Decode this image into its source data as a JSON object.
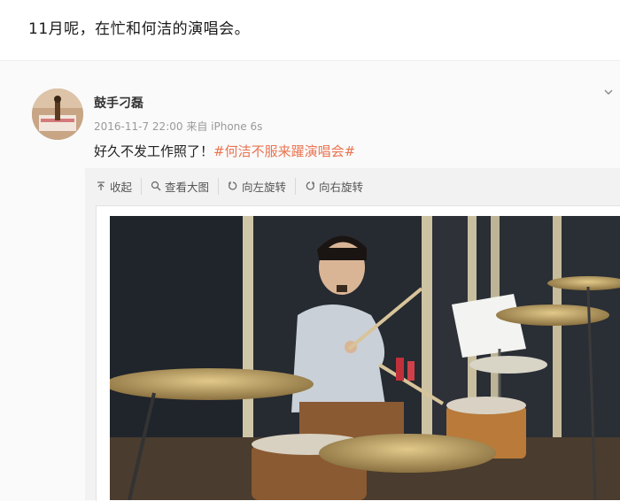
{
  "caption": "11月呢，在忙和何洁的演唱会。",
  "post": {
    "username": "鼓手刁磊",
    "timestamp": "2016-11-7 22:00",
    "source": "来自 iPhone 6s",
    "text": "好久不发工作照了！",
    "hashtag": "#何洁不服来躍演唱会#",
    "hashtag_color": "#eb7350"
  },
  "toolbar": {
    "collapse": "收起",
    "view_large": "查看大图",
    "rotate_left": "向左旋转",
    "rotate_right": "向右旋转"
  }
}
